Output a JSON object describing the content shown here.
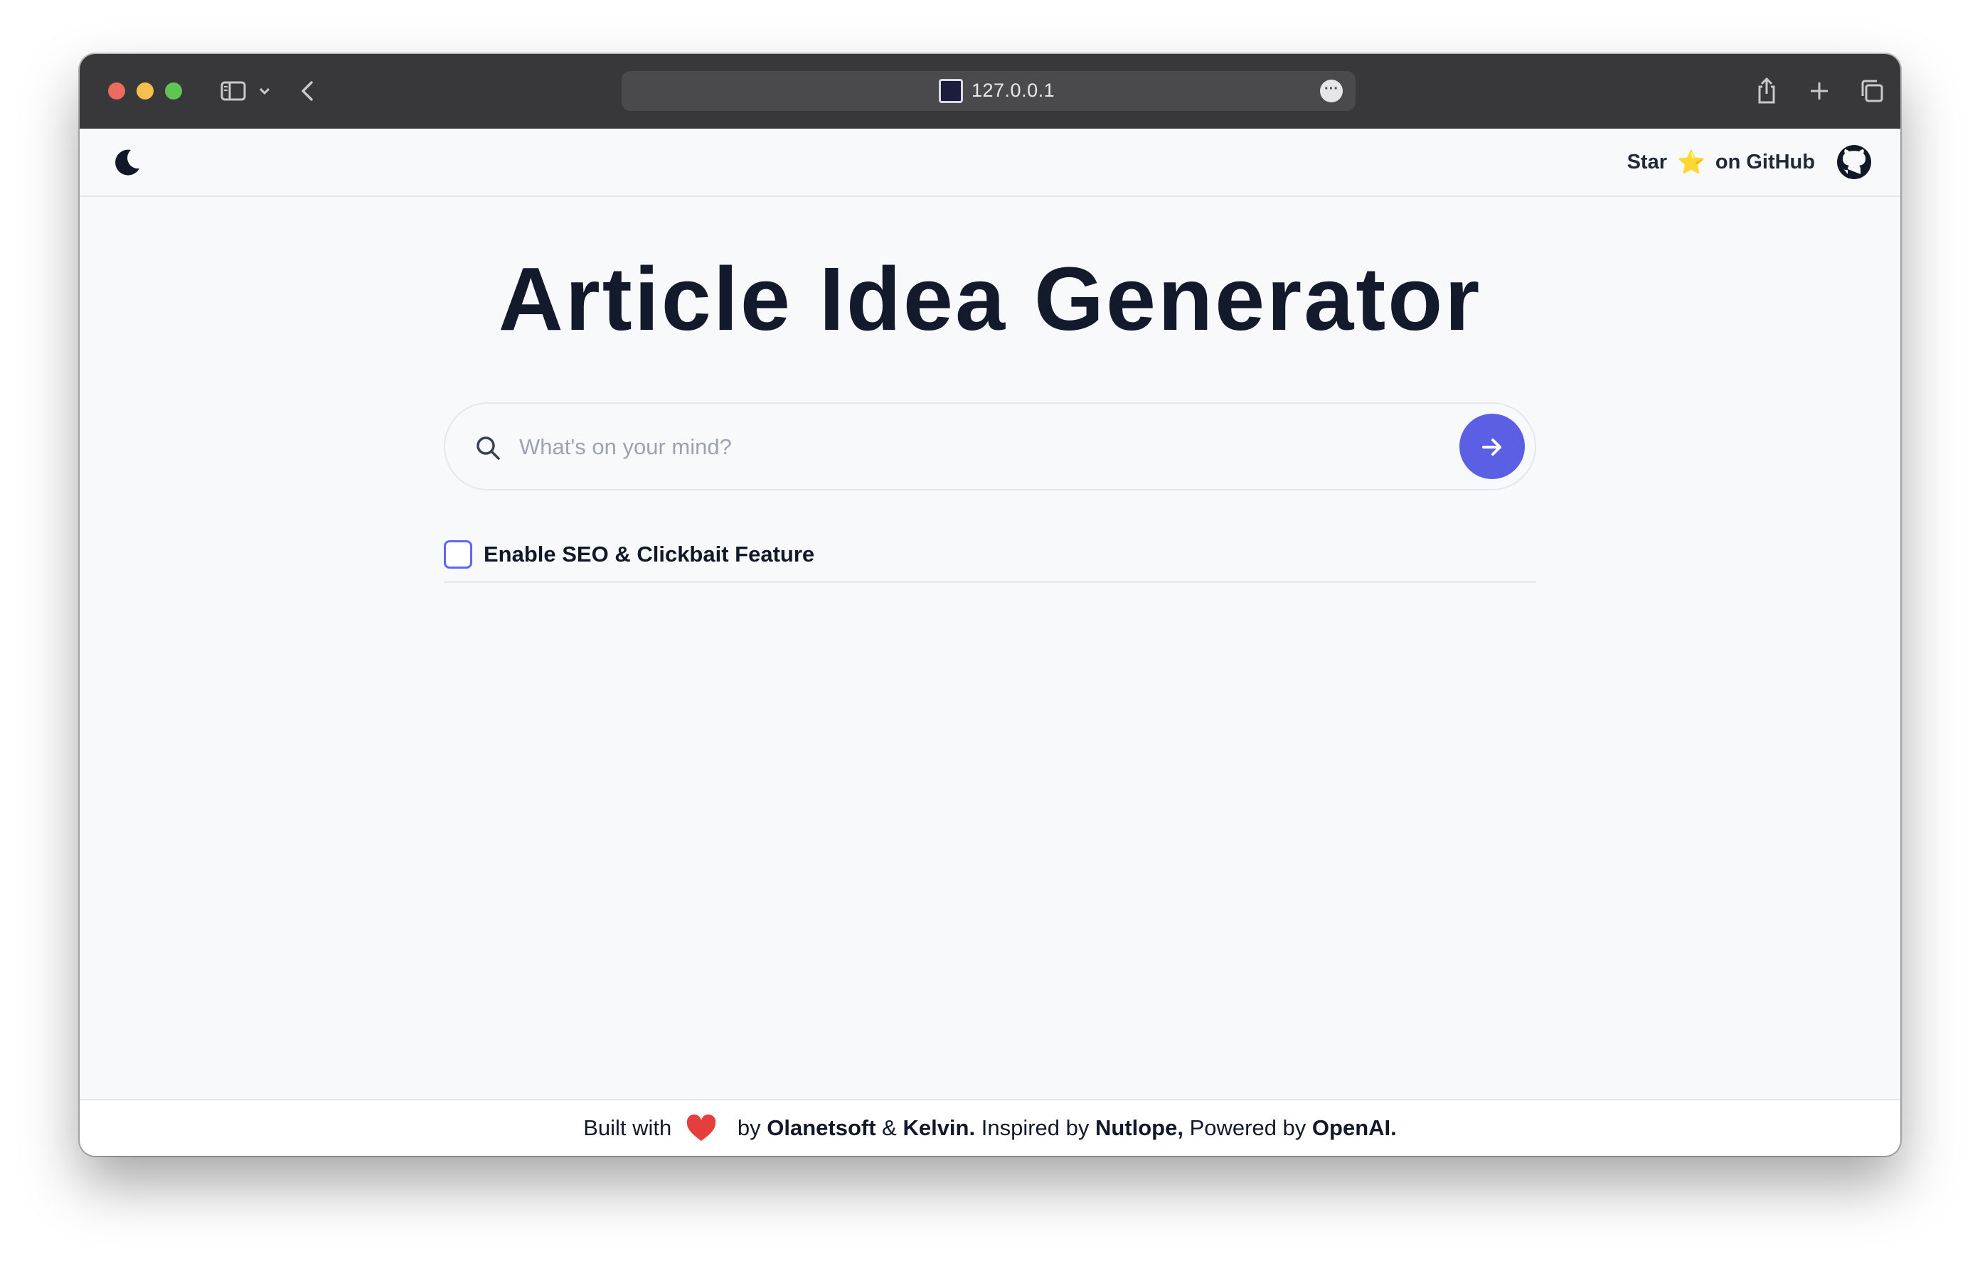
{
  "browser": {
    "url": "127.0.0.1"
  },
  "header": {
    "github_prefix": "Star",
    "github_star": "⭐",
    "github_suffix": "on GitHub"
  },
  "main": {
    "title": "Article Idea Generator",
    "search_placeholder": "What's on your mind?",
    "search_value": "",
    "seo_label": "Enable SEO & Clickbait Feature",
    "seo_checked": false
  },
  "footer": {
    "built_with": "Built with",
    "by": " by ",
    "author1": "Olanetsoft",
    "amp": " & ",
    "author2": "Kelvin.",
    "inspired": " Inspired by ",
    "inspiration": "Nutlope,",
    "powered": " Powered by ",
    "power": "OpenAI."
  },
  "colors": {
    "accent": "#5b5fe4",
    "titlebar": "#38383a",
    "heart": "#e53e3e"
  }
}
